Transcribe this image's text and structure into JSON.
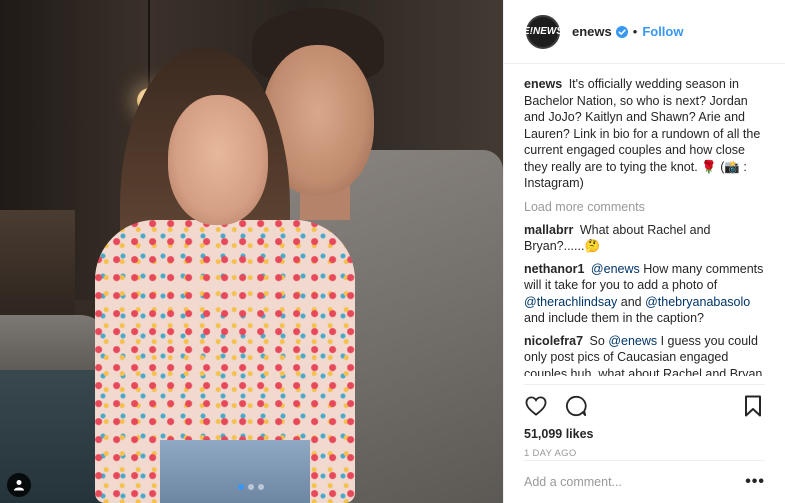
{
  "post": {
    "author": {
      "handle": "enews",
      "avatar_text": "E!NEWS",
      "verified_icon": "verified-badge-icon",
      "separator": "•",
      "follow_label": "Follow"
    },
    "caption": {
      "user": "enews",
      "text": "It's officially wedding season in Bachelor Nation, so who is next? Jordan and JoJo? Kaitlyn and Shawn? Arie and Lauren? Link in bio for a rundown of all the current engaged couples and how close they really are to tying the knot. 🌹 (📸 : Instagram)"
    },
    "load_more_label": "Load more comments",
    "comments": [
      {
        "user": "mallabrr",
        "text": "What about Rachel and Bryan?......🤔"
      },
      {
        "user": "nethanor1",
        "mention1": "@enews",
        "text1": " How many comments will it take for you to add a photo of ",
        "mention2": "@therachlindsay",
        "text2": " and ",
        "mention3": "@thebryanabasolo",
        "text3": " and include them in the caption?"
      },
      {
        "user": "nicolefra7",
        "text0": "So ",
        "mention1": "@enews",
        "text1": " I guess you could only post pics of Caucasian engaged couples huh .what about Rachel and Bryan I'm noticing a trend and I don't like it one bit. U have officially lost a viewer."
      }
    ],
    "likes": "51,099 likes",
    "date": "1 DAY AGO",
    "add_comment_placeholder": "Add a comment...",
    "more_options": "•••",
    "carousel": {
      "count": 3,
      "active_index": 0
    }
  },
  "icons": {
    "like": "heart-icon",
    "comment": "comment-bubble-icon",
    "save": "bookmark-icon",
    "tag": "user-tag-icon"
  },
  "colors": {
    "accent": "#3897f0",
    "mention": "#003569",
    "muted": "#999999"
  }
}
